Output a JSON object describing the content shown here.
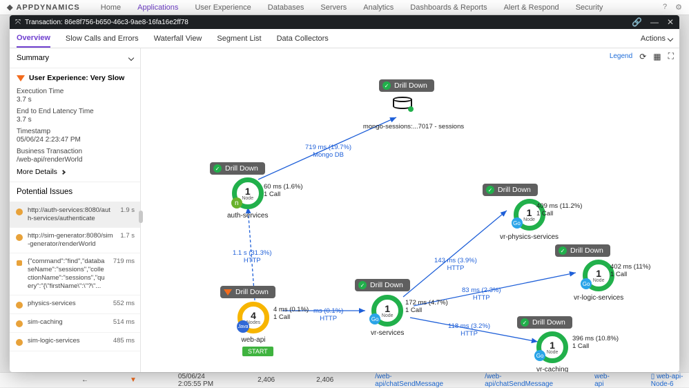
{
  "bg": {
    "brand": "APPDYNAMICS",
    "nav": [
      "Home",
      "Applications",
      "User Experience",
      "Databases",
      "Servers",
      "Analytics",
      "Dashboards & Reports",
      "Alert & Respond",
      "Security"
    ],
    "active_idx": 1,
    "footer": {
      "time": "05/06/24 2:05:55 PM",
      "v1": "2,406",
      "v2": "2,406",
      "bt": "/web-api/chatSendMessage",
      "bt2": "/web-api/chatSendMessage",
      "tier": "web-api",
      "node": "web-api-Node-6"
    }
  },
  "modal": {
    "title": "Transaction: 86e8f756-b650-46c3-9ae8-16fa16e2ff78",
    "tabs": [
      "Overview",
      "Slow Calls and Errors",
      "Waterfall View",
      "Segment List",
      "Data Collectors"
    ],
    "active_tab": 0,
    "actions_label": "Actions"
  },
  "summary": {
    "heading": "Summary",
    "ux_label": "User Experience: Very Slow",
    "rows": [
      {
        "lab": "Execution Time",
        "val": "3.7 s"
      },
      {
        "lab": "End to End Latency Time",
        "val": "3.7 s"
      },
      {
        "lab": "Timestamp",
        "val": "05/06/24 2:23:47 PM"
      }
    ],
    "bt_label": "Business Transaction",
    "bt_value": "/web-api/renderWorld",
    "more": "More Details"
  },
  "issues": {
    "heading": "Potential Issues",
    "items": [
      {
        "txt": "http://auth-services:8080/auth-services/authenticate",
        "ms": "1.9 s",
        "icon": "http"
      },
      {
        "txt": "http://sim-generator:8080/sim-generator/renderWorld",
        "ms": "1.7 s",
        "icon": "http"
      },
      {
        "txt": "{\"command\":\"find\",\"databaseName\":\"sessions\",\"collectionName\":\"sessions\",\"query\":\"{\\\"firstName\\\":\\\"?\\\"...",
        "ms": "719 ms",
        "icon": "db"
      },
      {
        "txt": "physics-services",
        "ms": "552 ms",
        "icon": "svc"
      },
      {
        "txt": "sim-caching",
        "ms": "514 ms",
        "icon": "svc"
      },
      {
        "txt": "sim-logic-services",
        "ms": "485 ms",
        "icon": "svc"
      }
    ],
    "selected": 0
  },
  "map": {
    "legend": "Legend",
    "nodes": {
      "mongo": {
        "pill": "Drill Down",
        "label": "mongo-sessions:...7017 - sessions"
      },
      "auth": {
        "pill": "Drill Down",
        "num": "1",
        "sub": "Node",
        "label": "auth-services",
        "side": "60 ms (1.6%)\n1 Call"
      },
      "webapi": {
        "pill": "Drill Down",
        "num": "4",
        "sub": "Nodes",
        "label": "web-api",
        "side": "4 ms (0.1%)\n1 Call",
        "start": "START"
      },
      "vrsvc": {
        "pill": "Drill Down",
        "num": "1",
        "sub": "Node",
        "label": "vr-services",
        "side": "172 ms (4.7%)\n1 Call"
      },
      "phys": {
        "pill": "Drill Down",
        "num": "1",
        "sub": "Node",
        "label": "vr-physics-services",
        "side": "409 ms (11.2%)\n1 Call"
      },
      "logic": {
        "pill": "Drill Down",
        "num": "1",
        "sub": "Node",
        "label": "vr-logic-services",
        "side": "402 ms (11%)\n1 Call"
      },
      "cache": {
        "pill": "Drill Down",
        "num": "1",
        "sub": "Node",
        "label": "vr-caching",
        "side": "396 ms (10.8%)\n1 Call"
      }
    },
    "edges": {
      "auth_mongo": "719 ms (19.7%)\nMongo DB",
      "web_auth": "1.1 s (31.3%)\nHTTP",
      "web_vr": "ms (0.1%)\nHTTP",
      "vr_phys": "143 ms (3.9%)\nHTTP",
      "vr_logic": "83 ms (2.3%)\nHTTP",
      "vr_cache": "118 ms (3.2%)\nHTTP"
    }
  }
}
